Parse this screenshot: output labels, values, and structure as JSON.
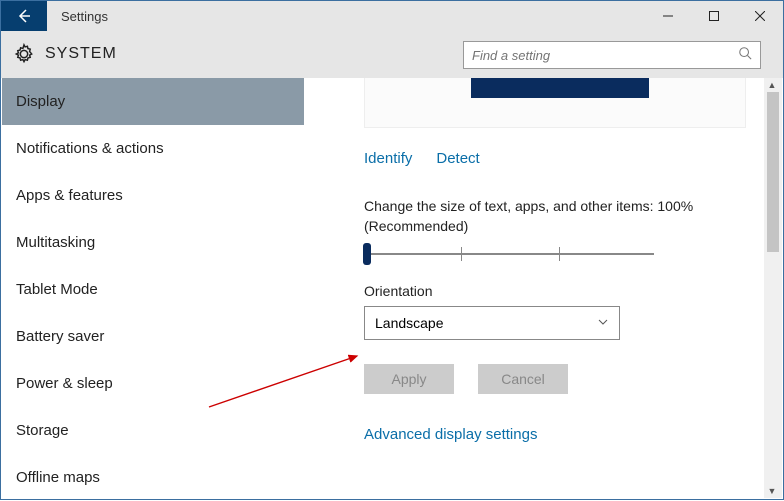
{
  "window": {
    "title": "Settings"
  },
  "header": {
    "section": "SYSTEM",
    "searchPlaceholder": "Find a setting"
  },
  "sidebar": {
    "items": [
      {
        "label": "Display",
        "selected": true
      },
      {
        "label": "Notifications & actions",
        "selected": false
      },
      {
        "label": "Apps & features",
        "selected": false
      },
      {
        "label": "Multitasking",
        "selected": false
      },
      {
        "label": "Tablet Mode",
        "selected": false
      },
      {
        "label": "Battery saver",
        "selected": false
      },
      {
        "label": "Power & sleep",
        "selected": false
      },
      {
        "label": "Storage",
        "selected": false
      },
      {
        "label": "Offline maps",
        "selected": false
      }
    ]
  },
  "content": {
    "identify": "Identify",
    "detect": "Detect",
    "scaleLabel": "Change the size of text, apps, and other items: 100% (Recommended)",
    "orientationLabel": "Orientation",
    "orientationValue": "Landscape",
    "applyLabel": "Apply",
    "cancelLabel": "Cancel",
    "advancedLink": "Advanced display settings"
  }
}
